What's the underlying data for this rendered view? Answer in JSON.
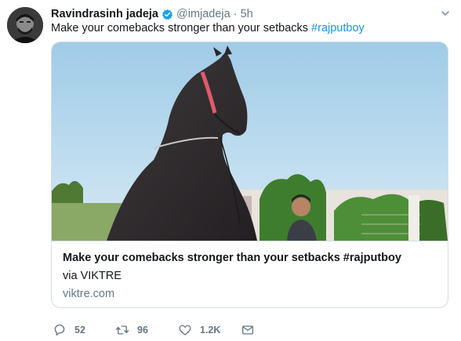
{
  "tweet": {
    "author_name": "Ravindrasinh jadeja",
    "handle": "@imjadeja",
    "separator": "·",
    "time": "5h",
    "text_plain": "Make your comebacks stronger than your setbacks ",
    "text_hashtag": "#rajputboy"
  },
  "card": {
    "title": "Make your comebacks stronger than your setbacks #rajputboy",
    "description": "via VIKTRE",
    "domain": "viktre.com"
  },
  "actions": {
    "reply_count": "52",
    "retweet_count": "96",
    "like_count": "1.2K"
  },
  "icons": {
    "verified": "verified-badge-icon",
    "caret": "chevron-down-icon",
    "reply": "reply-icon",
    "retweet": "retweet-icon",
    "like": "heart-icon",
    "dm": "envelope-icon"
  },
  "colors": {
    "hashtag": "#1b95e0",
    "muted": "#657786",
    "verified": "#1da1f2",
    "border": "#d5dde3"
  }
}
